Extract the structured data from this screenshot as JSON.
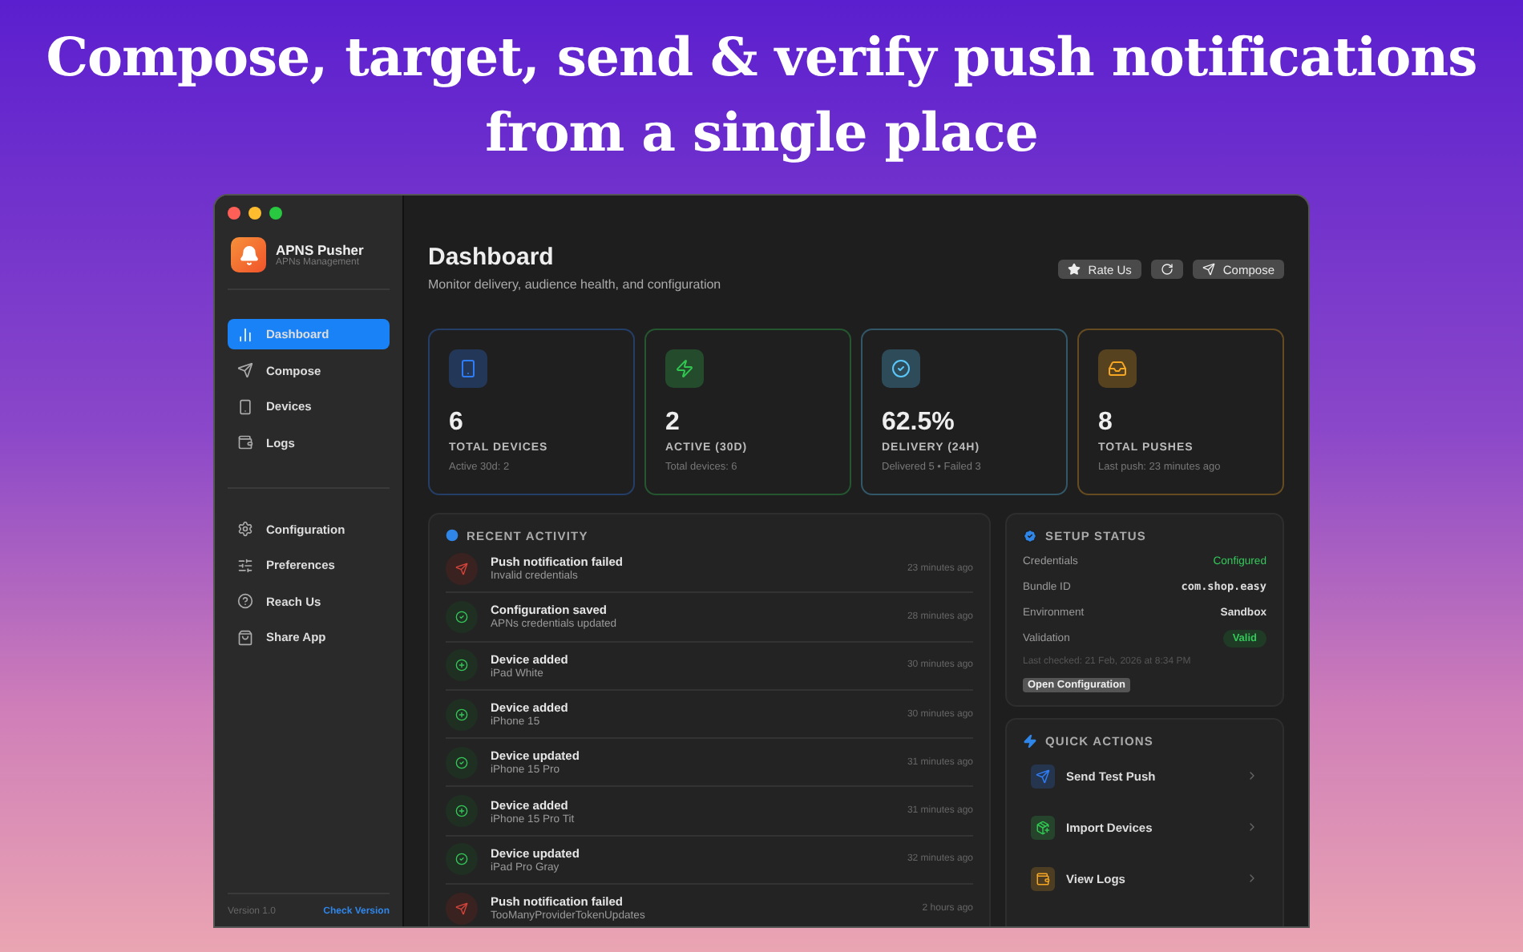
{
  "headline": [
    "Compose, target, send & verify push notifications",
    "from a single place"
  ],
  "sidebar": {
    "app_name": "APNS Pusher",
    "app_subtitle": "APNs Management",
    "nav": [
      {
        "label": "Dashboard",
        "selected": true
      },
      {
        "label": "Compose",
        "selected": false
      },
      {
        "label": "Devices",
        "selected": false
      },
      {
        "label": "Logs",
        "selected": false
      }
    ],
    "secondary": [
      {
        "label": "Configuration"
      },
      {
        "label": "Preferences"
      },
      {
        "label": "Reach Us"
      },
      {
        "label": "Share App"
      }
    ],
    "version": "Version 1.0",
    "check_version": "Check Version"
  },
  "header": {
    "title": "Dashboard",
    "subtitle": "Monitor delivery, audience health, and configuration",
    "buttons": [
      {
        "kind": "rate",
        "label": "Rate Us"
      },
      {
        "kind": "refresh"
      },
      {
        "kind": "compose",
        "label": "Compose"
      }
    ]
  },
  "stats": [
    {
      "value": "6",
      "label": "TOTAL DEVICES",
      "detail": "Active 30d: 2",
      "color": "#2f7df6"
    },
    {
      "value": "2",
      "label": "ACTIVE (30D)",
      "detail": "Total devices: 6",
      "color": "#30c750"
    },
    {
      "value": "62.5%",
      "label": "DELIVERY (24H)",
      "detail": "Delivered 5 • Failed 3",
      "color": "#5ac8fa"
    },
    {
      "value": "8",
      "label": "TOTAL PUSHES",
      "detail": "Last push: 23 minutes ago",
      "color": "#f5a623"
    }
  ],
  "activity": {
    "title": "RECENT ACTIVITY",
    "items": [
      {
        "kind": "failed",
        "title": "Push notification failed",
        "subtitle": "Invalid credentials",
        "time": "23 minutes ago"
      },
      {
        "kind": "check",
        "title": "Configuration saved",
        "subtitle": "APNs credentials updated",
        "time": "28 minutes ago"
      },
      {
        "kind": "added",
        "title": "Device added",
        "subtitle": "iPad White",
        "time": "30 minutes ago"
      },
      {
        "kind": "added",
        "title": "Device added",
        "subtitle": "iPhone 15",
        "time": "30 minutes ago"
      },
      {
        "kind": "check",
        "title": "Device updated",
        "subtitle": "iPhone 15 Pro",
        "time": "31 minutes ago"
      },
      {
        "kind": "added",
        "title": "Device added",
        "subtitle": "iPhone 15 Pro Tit",
        "time": "31 minutes ago"
      },
      {
        "kind": "check",
        "title": "Device updated",
        "subtitle": "iPad Pro Gray",
        "time": "32 minutes ago"
      },
      {
        "kind": "failed",
        "title": "Push notification failed",
        "subtitle": "TooManyProviderTokenUpdates",
        "time": "2 hours ago"
      }
    ]
  },
  "setup": {
    "title": "SETUP STATUS",
    "rows": [
      {
        "kind": "status",
        "label": "Credentials",
        "value": "Configured"
      },
      {
        "kind": "mono",
        "label": "Bundle ID",
        "value": "com.shop.easy"
      },
      {
        "kind": "plain",
        "label": "Environment",
        "value": "Sandbox"
      },
      {
        "kind": "badge",
        "label": "Validation",
        "value": "Valid"
      }
    ],
    "last_checked": "Last checked: 21 Feb, 2026 at 8:34 PM",
    "button": "Open Configuration"
  },
  "quick_actions": {
    "title": "QUICK ACTIONS",
    "items": [
      {
        "label": "Send Test Push",
        "color": "#2f7df6"
      },
      {
        "label": "Import Devices",
        "color": "#30c750"
      },
      {
        "label": "View Logs",
        "color": "#f5a623"
      }
    ]
  }
}
